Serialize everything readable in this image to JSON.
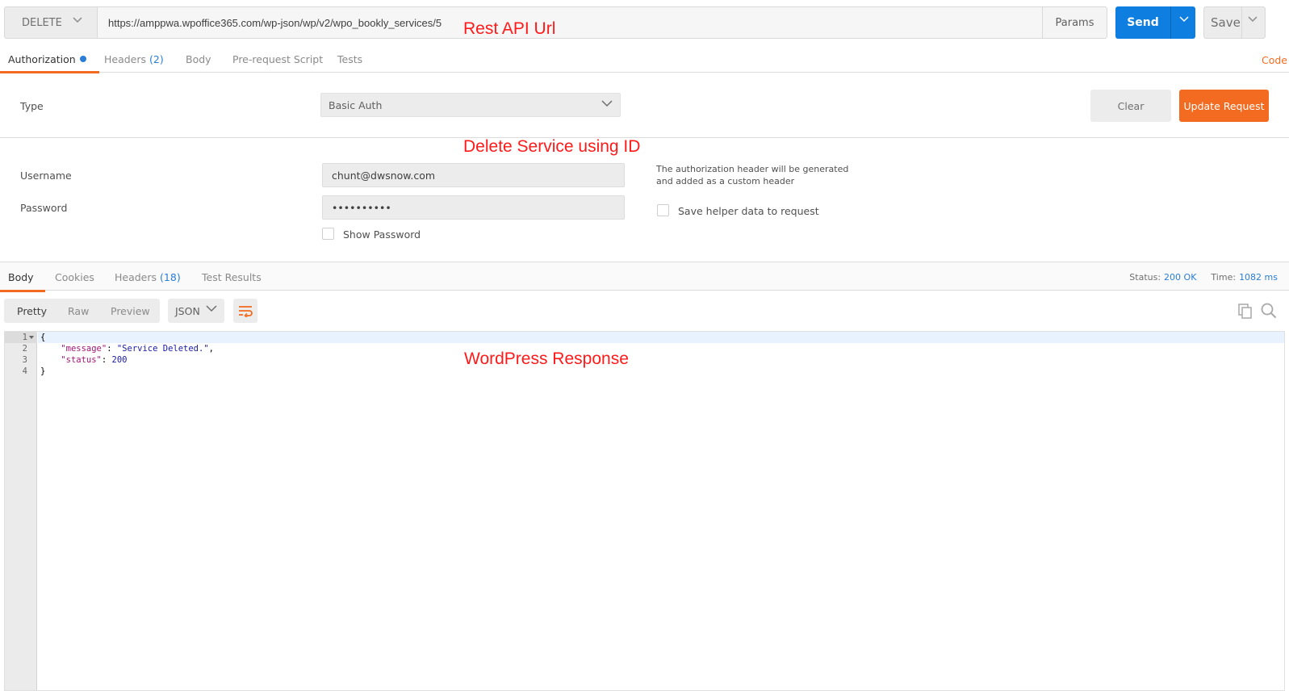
{
  "request": {
    "method": "DELETE",
    "url": "https://amppwa.wpoffice365.com/wp-json/wp/v2/wpo_bookly_services/5",
    "params_label": "Params",
    "send_label": "Send",
    "save_label": "Save"
  },
  "annotations": {
    "url_note": "Rest API Url",
    "delete_note": "Delete Service using ID",
    "response_note": "WordPress Response"
  },
  "request_tabs": {
    "authorization": "Authorization",
    "headers": "Headers",
    "headers_count": "(2)",
    "body": "Body",
    "prerequest": "Pre-request Script",
    "tests": "Tests",
    "code_link": "Code"
  },
  "auth": {
    "type_label": "Type",
    "type_value": "Basic Auth",
    "clear_label": "Clear",
    "update_label": "Update Request",
    "username_label": "Username",
    "username_value": "chunt@dwsnow.com",
    "password_label": "Password",
    "password_value": "••••••••••",
    "show_password_label": "Show Password",
    "helper_text": "The authorization header will be generated and added as a custom header",
    "save_helper_label": "Save helper data to request"
  },
  "response_tabs": {
    "body": "Body",
    "cookies": "Cookies",
    "headers": "Headers",
    "headers_count": "(18)",
    "test_results": "Test Results",
    "status_label": "Status:",
    "status_value": "200 OK",
    "time_label": "Time:",
    "time_value": "1082 ms"
  },
  "response_view": {
    "pretty": "Pretty",
    "raw": "Raw",
    "preview": "Preview",
    "format": "JSON"
  },
  "response_body": {
    "lines": [
      "1",
      "2",
      "3",
      "4"
    ],
    "open_brace": "{",
    "message_key": "\"message\"",
    "message_value": "\"Service Deleted.\"",
    "status_key": "\"status\"",
    "status_value": "200",
    "close_brace": "}"
  },
  "colors": {
    "send_blue": "#0e7fe1",
    "accent_orange": "#f26b21",
    "link_blue": "#2a7dd8",
    "annotation_red": "#ff1a1a"
  }
}
